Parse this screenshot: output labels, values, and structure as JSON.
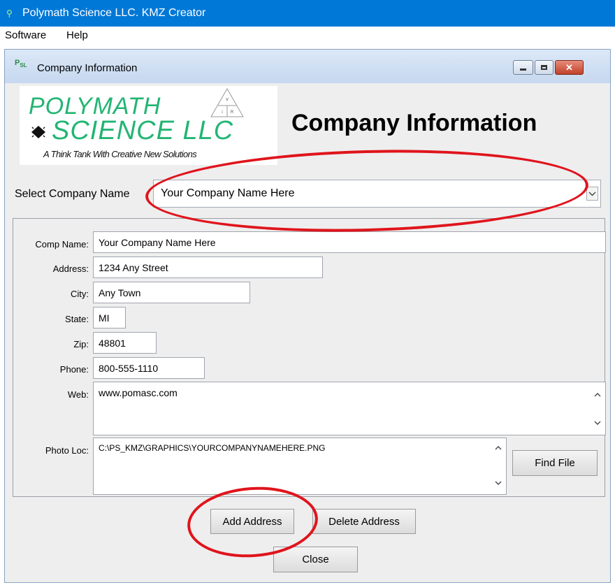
{
  "app": {
    "title": "Polymath Science LLC. KMZ Creator",
    "icon": "app-icon"
  },
  "menu": {
    "items": [
      "Software",
      "Help"
    ]
  },
  "dialog": {
    "title": "Company Information",
    "controls": [
      "minimize",
      "maximize",
      "close"
    ]
  },
  "logo": {
    "line1": "POLYMATH",
    "line2": "SCIENCE LLC",
    "tagline": "A Think Tank With Creative New Solutions",
    "triangle_top": "v",
    "triangle_bottom_left": "i",
    "triangle_bottom_right": "R"
  },
  "heading": "Company Information",
  "select": {
    "label": "Select Company Name",
    "value": "Your Company Name Here"
  },
  "fields": {
    "comp_name": {
      "label": "Comp Name:",
      "value": "Your Company Name Here"
    },
    "address": {
      "label": "Address:",
      "value": "1234 Any Street"
    },
    "city": {
      "label": "City:",
      "value": "Any Town"
    },
    "state": {
      "label": "State:",
      "value": "MI"
    },
    "zip": {
      "label": "Zip:",
      "value": "48801"
    },
    "phone": {
      "label": "Phone:",
      "value": "800-555-1110"
    },
    "web": {
      "label": "Web:",
      "value": "www.pomasc.com"
    },
    "photo_loc": {
      "label": "Photo Loc:",
      "value": "C:\\PS_KMZ\\GRAPHICS\\YOURCOMPANYNAMEHERE.PNG"
    }
  },
  "buttons": {
    "find_file": "Find File",
    "add_address": "Add Address",
    "delete_address": "Delete Address",
    "close": "Close"
  },
  "colors": {
    "titlebar": "#0078d7",
    "logo_green": "#22b573",
    "annotation_red": "#e0141c"
  }
}
